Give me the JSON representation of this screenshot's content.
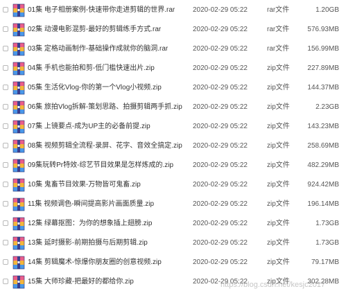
{
  "colors": {
    "icon_top": "#e95d8a",
    "icon_mid": "#f4b63a",
    "icon_bottom": "#4a97e8",
    "icon_band": "#3a3f8f"
  },
  "files": [
    {
      "name": "01集 电子相册案例-快速带你走进剪辑的世界.rar",
      "date": "2020-02-29 05:22",
      "type": "rar文件",
      "size": "1.20GB",
      "icon": "archive-icon"
    },
    {
      "name": "02集 动漫电影混剪-最好的剪辑练手方式.rar",
      "date": "2020-02-29 05:22",
      "type": "rar文件",
      "size": "576.93MB",
      "icon": "archive-icon"
    },
    {
      "name": "03集 定格动画制作-基础操作成就你的脑洞.rar",
      "date": "2020-02-29 05:22",
      "type": "rar文件",
      "size": "156.99MB",
      "icon": "archive-icon"
    },
    {
      "name": "04集 手机也能拍和剪-低门槛快速出片.zip",
      "date": "2020-02-29 05:22",
      "type": "zip文件",
      "size": "227.89MB",
      "icon": "archive-icon"
    },
    {
      "name": "05集 生活化Vlog-你的第一个Vlog小视频.zip",
      "date": "2020-02-29 05:22",
      "type": "zip文件",
      "size": "144.37MB",
      "icon": "archive-icon"
    },
    {
      "name": "06集 旅拍Vlog拆解-策划思路、拍摄剪辑两手抓.zip",
      "date": "2020-02-29 05:22",
      "type": "zip文件",
      "size": "2.23GB",
      "icon": "archive-icon"
    },
    {
      "name": "07集 上镜要点-成为UP主的必备前提.zip",
      "date": "2020-02-29 05:22",
      "type": "zip文件",
      "size": "143.23MB",
      "icon": "archive-icon"
    },
    {
      "name": "08集 视频剪辑全流程-录屏、花字、音效全搞定.zip",
      "date": "2020-02-29 05:22",
      "type": "zip文件",
      "size": "258.69MB",
      "icon": "archive-icon"
    },
    {
      "name": "09集玩转Pr特效-综艺节目效果是怎样炼成的.zip",
      "date": "2020-02-29 05:22",
      "type": "zip文件",
      "size": "482.29MB",
      "icon": "archive-icon"
    },
    {
      "name": "10集 鬼畜节目效果-万物皆可鬼畜.zip",
      "date": "2020-02-29 05:22",
      "type": "zip文件",
      "size": "924.42MB",
      "icon": "archive-icon"
    },
    {
      "name": "11集 视频调色-瞬间提高影片画面质量.zip",
      "date": "2020-02-29 05:22",
      "type": "zip文件",
      "size": "196.14MB",
      "icon": "archive-icon"
    },
    {
      "name": "12集 绿幕抠图：为你的想象插上翅膀.zip",
      "date": "2020-02-29 05:22",
      "type": "zip文件",
      "size": "1.73GB",
      "icon": "archive-icon"
    },
    {
      "name": "13集 延时摄影-前期拍摄与后期剪辑.zip",
      "date": "2020-02-29 05:22",
      "type": "zip文件",
      "size": "1.73GB",
      "icon": "archive-icon"
    },
    {
      "name": "14集 剪辑魔术-惊爆你朋友圈的创意视频.zip",
      "date": "2020-02-29 05:22",
      "type": "zip文件",
      "size": "79.17MB",
      "icon": "archive-icon"
    },
    {
      "name": "15集 大师珍藏-把最好的都给你.zip",
      "date": "2020-02-29 05:22",
      "type": "zip文件",
      "size": "302.28MB",
      "icon": "archive-icon"
    }
  ],
  "watermark": "https://blog.csdn.net/kesjc2017"
}
